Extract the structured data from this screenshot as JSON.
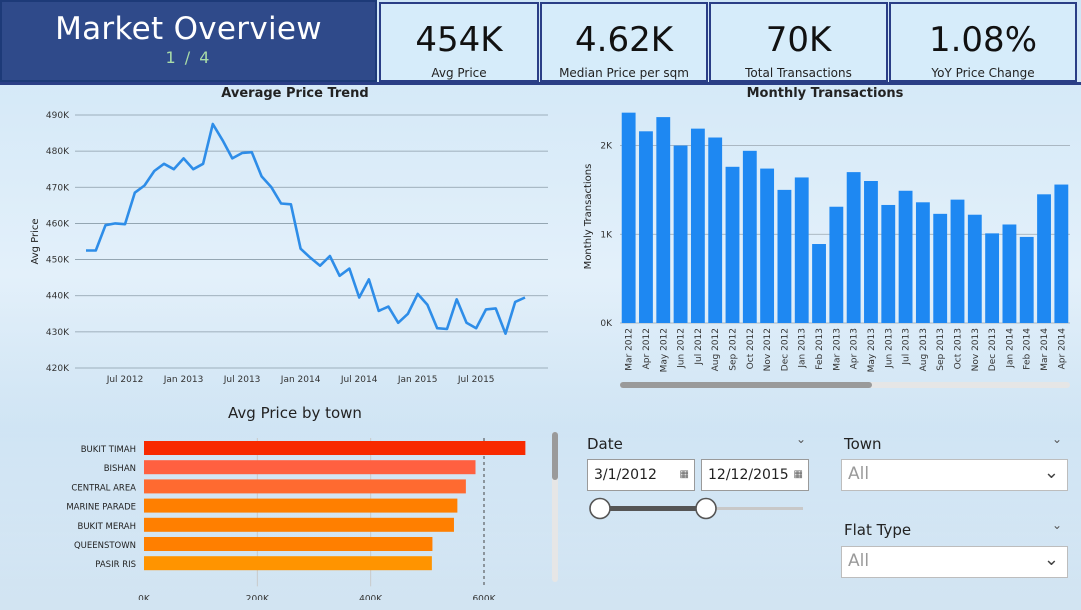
{
  "header": {
    "title": "Market Overview",
    "page": "1 / 4"
  },
  "kpis": [
    {
      "value": "454K",
      "label": "Avg Price"
    },
    {
      "value": "4.62K",
      "label": "Median Price per sqm"
    },
    {
      "value": "70K",
      "label": "Total Transactions"
    },
    {
      "value": "1.08%",
      "label": "YoY Price Change"
    }
  ],
  "colors": {
    "bar_blue": "#1e88f2",
    "line_blue": "#2e8de8",
    "header_navy": "#2f4a8a",
    "accent_red": "#f82a00",
    "orange": "#ff7a00"
  },
  "chart_data": [
    {
      "type": "line",
      "title": "Average Price Trend",
      "ylabel": "Avg Price",
      "xlabel": "",
      "y_ticks": [
        "420K",
        "430K",
        "440K",
        "450K",
        "460K",
        "470K",
        "480K",
        "490K"
      ],
      "x_ticks": [
        "Jul 2012",
        "Jan 2013",
        "Jul 2013",
        "Jan 2014",
        "Jul 2014",
        "Jan 2015",
        "Jul 2015"
      ],
      "ylim": [
        420,
        490
      ],
      "y_unit": "K",
      "x": [
        "Mar 2012",
        "Apr 2012",
        "May 2012",
        "Jun 2012",
        "Jul 2012",
        "Aug 2012",
        "Sep 2012",
        "Oct 2012",
        "Nov 2012",
        "Dec 2012",
        "Jan 2013",
        "Feb 2013",
        "Mar 2013",
        "Apr 2013",
        "May 2013",
        "Jun 2013",
        "Jul 2013",
        "Aug 2013",
        "Sep 2013",
        "Oct 2013",
        "Nov 2013",
        "Dec 2013",
        "Jan 2014",
        "Feb 2014",
        "Mar 2014",
        "Apr 2014",
        "May 2014",
        "Jun 2014",
        "Jul 2014",
        "Aug 2014",
        "Sep 2014",
        "Oct 2014",
        "Nov 2014",
        "Dec 2014",
        "Jan 2015",
        "Feb 2015",
        "Mar 2015",
        "Apr 2015",
        "May 2015",
        "Jun 2015",
        "Jul 2015",
        "Aug 2015",
        "Sep 2015",
        "Oct 2015",
        "Nov 2015",
        "Dec 2015"
      ],
      "values": [
        452.5,
        452.5,
        459.5,
        460,
        459.8,
        468.5,
        470.5,
        474.5,
        476.5,
        475,
        478,
        475,
        476.5,
        487.5,
        483,
        478,
        479.5,
        479.7,
        473,
        470,
        465.5,
        465.3,
        453,
        450.5,
        448.3,
        451,
        445.5,
        447.5,
        439.5,
        444.5,
        435.8,
        437,
        432.5,
        435,
        440.5,
        437.5,
        431,
        430.8,
        439,
        432.5,
        431,
        436.2,
        436.5,
        429.5,
        438.3,
        439.5
      ]
    },
    {
      "type": "bar",
      "title": "Monthly Transactions",
      "ylabel": "Monthly Transactions",
      "xlabel": "",
      "y_ticks": [
        "0K",
        "1K",
        "2K"
      ],
      "ylim": [
        0,
        2.4
      ],
      "y_unit": "K",
      "categories": [
        "Mar 2012",
        "Apr 2012",
        "May 2012",
        "Jun 2012",
        "Jul 2012",
        "Aug 2012",
        "Sep 2012",
        "Oct 2012",
        "Nov 2012",
        "Dec 2012",
        "Jan 2013",
        "Feb 2013",
        "Mar 2013",
        "Apr 2013",
        "May 2013",
        "Jun 2013",
        "Jul 2013",
        "Aug 2013",
        "Sep 2013",
        "Oct 2013",
        "Nov 2013",
        "Dec 2013",
        "Jan 2014",
        "Feb 2014",
        "Mar 2014",
        "Apr 2014"
      ],
      "values": [
        2.37,
        2.16,
        2.32,
        2.0,
        2.19,
        2.09,
        1.76,
        1.94,
        1.74,
        1.5,
        1.64,
        0.89,
        1.31,
        1.7,
        1.6,
        1.33,
        1.49,
        1.36,
        1.23,
        1.39,
        1.22,
        1.01,
        1.11,
        0.97,
        1.45,
        1.56
      ]
    },
    {
      "type": "bar",
      "orientation": "horizontal",
      "title": "Avg Price by town",
      "xlabel": "",
      "ylabel": "",
      "x_ticks": [
        "0K",
        "200K",
        "400K",
        "600K"
      ],
      "xlim": [
        0,
        720
      ],
      "x_unit": "K",
      "categories": [
        "BUKIT TIMAH",
        "BISHAN",
        "CENTRAL AREA",
        "MARINE PARADE",
        "BUKIT MERAH",
        "QUEENSTOWN",
        "PASIR RIS"
      ],
      "values": [
        673,
        585,
        568,
        553,
        547,
        509,
        508
      ],
      "colors": [
        "#f82a00",
        "#ff6040",
        "#ff6a30",
        "#ff7f00",
        "#ff7f00",
        "#ff7f00",
        "#ff9400"
      ]
    }
  ],
  "slicers": {
    "date": {
      "label": "Date",
      "start": "3/1/2012",
      "end": "12/12/2015"
    },
    "town": {
      "label": "Town",
      "value": "All"
    },
    "flat_type": {
      "label": "Flat Type",
      "value": "All"
    }
  }
}
